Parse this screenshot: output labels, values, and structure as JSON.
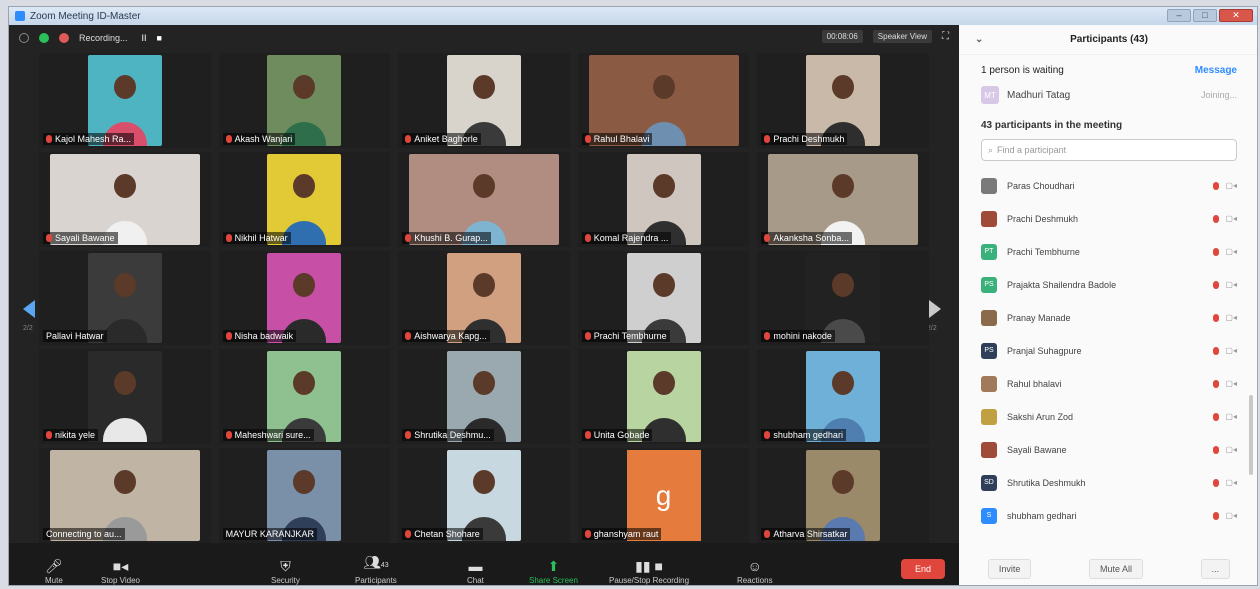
{
  "window": {
    "title": "Zoom Meeting ID-Master"
  },
  "topbar": {
    "recording_label": "Recording...",
    "pause_glyph": "II",
    "stop_glyph": "■",
    "timer": "00:08:06",
    "view_label": "Speaker View"
  },
  "tiles": [
    {
      "name": "Kajol Mahesh Ra...",
      "muted": true,
      "bg": "#4fb4c2",
      "shirt": "#d94f6b"
    },
    {
      "name": "Akash Wanjari",
      "muted": true,
      "bg": "#6f8c5e",
      "shirt": "#2f6e4a"
    },
    {
      "name": "Aniket Baghorle",
      "muted": true,
      "bg": "#d8d4cc",
      "shirt": "#3a3a3a"
    },
    {
      "name": "Rahul Bhalavi",
      "muted": true,
      "bg": "#8a5a42",
      "shirt": "#6f8fb0",
      "wide": true
    },
    {
      "name": "Prachi Deshmukh",
      "muted": true,
      "bg": "#c9b9a8",
      "shirt": "#2e2e2e"
    },
    {
      "name": "Sayali Bawane",
      "muted": true,
      "bg": "#d9d4d0",
      "shirt": "#f0f0f0",
      "wide": true
    },
    {
      "name": "Nikhil Hatwar",
      "muted": true,
      "bg": "#e2c936",
      "shirt": "#2f6fb0"
    },
    {
      "name": "Khushi B. Gurap...",
      "muted": true,
      "bg": "#b08d80",
      "shirt": "#7fb4d0",
      "wide": true
    },
    {
      "name": "Komal Rajendra ...",
      "muted": true,
      "bg": "#cfc6c0",
      "shirt": "#2f2f2f"
    },
    {
      "name": "Akanksha Sonba...",
      "muted": true,
      "bg": "#a89a88",
      "shirt": "#f2f2f2",
      "wide": true
    },
    {
      "name": "Pallavi Hatwar",
      "muted": false,
      "bg": "#3b3b3b",
      "shirt": "#2a2a2a"
    },
    {
      "name": "Nisha badwaik",
      "muted": true,
      "bg": "#c84fa6",
      "shirt": "#2a2a2a"
    },
    {
      "name": "Aishwarya Kapg...",
      "muted": true,
      "bg": "#d0a080",
      "shirt": "#2f2f2f"
    },
    {
      "name": "Prachi Tembhurne",
      "muted": true,
      "bg": "#cfcfcf",
      "shirt": "#3a3a3a"
    },
    {
      "name": "mohini nakode",
      "muted": true,
      "bg": "#222222",
      "shirt": "#4a4a4a"
    },
    {
      "name": "nikita yele",
      "muted": true,
      "bg": "#2a2a2a",
      "shirt": "#e8e8e8"
    },
    {
      "name": "Maheshwari sure...",
      "muted": true,
      "bg": "#8fc08f",
      "shirt": "#3a3a3a"
    },
    {
      "name": "Shrutika Deshmu...",
      "muted": true,
      "bg": "#9aa8b0",
      "shirt": "#2a2a2a"
    },
    {
      "name": "Unita Gobade",
      "muted": true,
      "bg": "#b8d4a0",
      "shirt": "#2f2f2f"
    },
    {
      "name": "shubham gedhari",
      "muted": true,
      "bg": "#6fb0d8",
      "shirt": "#4f7fb0"
    },
    {
      "name": "Connecting to au...",
      "muted": false,
      "bg": "#c0b4a4",
      "shirt": "#9a9a9a",
      "wide": true
    },
    {
      "name": "MAYUR KARANJKAR",
      "muted": false,
      "bg": "#7a8fa8",
      "shirt": "#2f3f5a"
    },
    {
      "name": "Chetan Shohare",
      "muted": true,
      "bg": "#c8d8e0",
      "shirt": "#3a3a3a"
    },
    {
      "name": "ghanshyam raut",
      "muted": true,
      "avatar": "g"
    },
    {
      "name": "Atharva Shirsatkar",
      "muted": true,
      "bg": "#9a8a6a",
      "shirt": "#5a7ab0"
    }
  ],
  "pager": {
    "left": "2/2",
    "right": "2/2"
  },
  "toolbar": {
    "mute": "Mute",
    "stop_video": "Stop Video",
    "security": "Security",
    "participants": "Participants",
    "participants_count": "43",
    "chat": "Chat",
    "share_screen": "Share Screen",
    "pause_recording": "Pause/Stop Recording",
    "reactions": "Reactions",
    "end": "End"
  },
  "panel": {
    "title": "Participants (43)",
    "waiting_label": "1 person is waiting",
    "message_label": "Message",
    "waiting_person": {
      "initials": "MT",
      "name": "Madhuri Tatag",
      "state": "Joining..."
    },
    "in_meeting_label": "43 participants in the meeting",
    "search_placeholder": "Find a participant",
    "participants": [
      {
        "name": "Paras Choudhari",
        "initials": "",
        "color": "#7a7a7a"
      },
      {
        "name": "Prachi Deshmukh",
        "initials": "",
        "color": "#a04a3a"
      },
      {
        "name": "Prachi Tembhurne",
        "initials": "PT",
        "color": "#3ab07a"
      },
      {
        "name": "Prajakta Shailendra Badole",
        "initials": "PS",
        "color": "#3ab07a"
      },
      {
        "name": "Pranay Manade",
        "initials": "",
        "color": "#8a6a4a"
      },
      {
        "name": "Pranjal Suhagpure",
        "initials": "PS",
        "color": "#2f3f5a"
      },
      {
        "name": "Rahul bhalavi",
        "initials": "",
        "color": "#a07a5a"
      },
      {
        "name": "Sakshi Arun Zod",
        "initials": "",
        "color": "#c0a040"
      },
      {
        "name": "Sayali Bawane",
        "initials": "",
        "color": "#a04a3a"
      },
      {
        "name": "Shrutika Deshmukh",
        "initials": "SD",
        "color": "#2f3f5a"
      },
      {
        "name": "shubham gedhari",
        "initials": "S",
        "color": "#2d8cff"
      }
    ],
    "footer": {
      "invite": "Invite",
      "mute_all": "Mute All",
      "more": "..."
    }
  }
}
